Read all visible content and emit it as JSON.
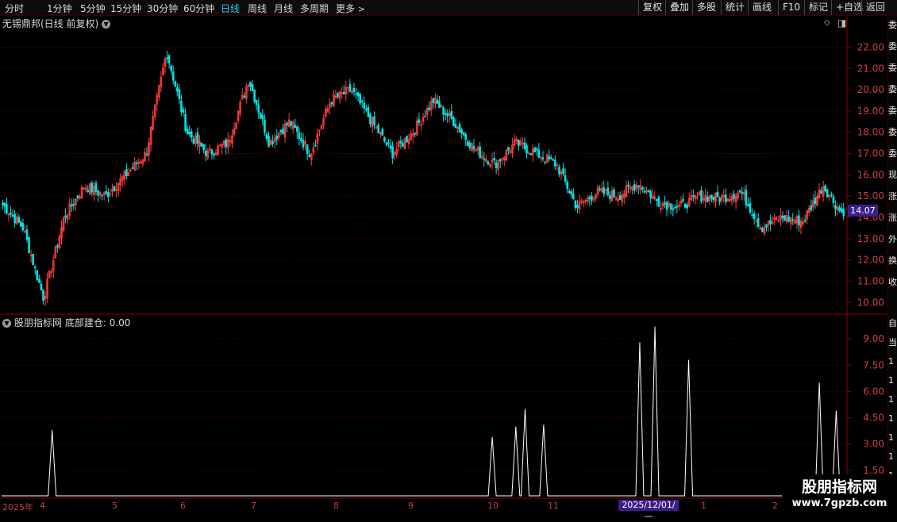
{
  "toolbar": {
    "timeframes": [
      "分时",
      "1分钟",
      "5分钟",
      "15分钟",
      "30分钟",
      "60分钟",
      "日线",
      "周线",
      "月线",
      "多周期",
      "更多"
    ],
    "active_timeframe": "日线",
    "more_arrow": ">",
    "buttons": [
      "复权",
      "叠加",
      "多股",
      "统计",
      "画线",
      "F10",
      "标记",
      "+自选",
      "返回"
    ]
  },
  "chart_title": "无锡鼎邦(日线 前复权)",
  "indicator_title": "股朋指标网 底部建仓: 0.00",
  "last_price_tag": "14.07",
  "highlight_date": "2025/12/01/—",
  "watermark": {
    "line1": "股朋指标网",
    "line2": "www.7gpzb.com"
  },
  "side_panel_chars": [
    "委",
    "委",
    "委",
    "委",
    "委",
    "委",
    "委",
    "现",
    "涨",
    "涨",
    "外",
    "换",
    "收"
  ],
  "side_panel_lower_chars": [
    "自",
    "当",
    "1",
    "1",
    "1",
    "1",
    "1",
    "1",
    "1"
  ],
  "icons": {
    "collapse": "chevron-down-icon",
    "diamond": "diamond-icon",
    "window": "window-icon"
  },
  "colors": {
    "up": "#ff3d3d",
    "down": "#00e5e5",
    "bg": "#000000",
    "grid": "#5a0000",
    "axis": "#8b0000",
    "active": "#35c4ff",
    "tag": "#3e1d8a"
  },
  "chart_data": [
    {
      "type": "candlestick",
      "yticks": [
        "10.00",
        "11.00",
        "12.00",
        "13.00",
        "14.00",
        "15.00",
        "16.00",
        "17.00",
        "18.00",
        "19.00",
        "20.00",
        "21.00",
        "22.00"
      ],
      "ylim": [
        9.6,
        22.8
      ],
      "x_labels": [
        "2025年",
        "4",
        "5",
        "6",
        "7",
        "8",
        "9",
        "10",
        "11",
        "2025/12/01/—",
        "1",
        "2"
      ],
      "close_path": [
        14.6,
        13.5,
        10.2,
        14.0,
        15.5,
        15.0,
        16.0,
        17.0,
        21.8,
        18.0,
        17.0,
        17.5,
        20.5,
        17.5,
        18.5,
        17.0,
        19.5,
        20.0,
        18.5,
        17.0,
        18.0,
        19.5,
        18.5,
        17.2,
        16.5,
        17.5,
        17.0,
        16.5,
        14.5,
        15.2,
        15.0,
        15.6,
        14.7,
        14.5,
        15.0,
        14.9,
        15.2,
        13.5,
        14.0,
        13.8,
        15.5,
        14.07
      ],
      "last": 14.07
    },
    {
      "type": "line",
      "name": "底部建仓",
      "yticks": [
        "1.50",
        "3.00",
        "4.50",
        "6.00",
        "7.50",
        "9.00"
      ],
      "ylim": [
        0,
        10
      ],
      "peaks": [
        {
          "i": 0.06,
          "v": 3.8
        },
        {
          "i": 0.582,
          "v": 3.4
        },
        {
          "i": 0.61,
          "v": 4.0
        },
        {
          "i": 0.621,
          "v": 5.0
        },
        {
          "i": 0.643,
          "v": 4.1
        },
        {
          "i": 0.757,
          "v": 8.8
        },
        {
          "i": 0.775,
          "v": 9.7
        },
        {
          "i": 0.815,
          "v": 7.8
        },
        {
          "i": 0.97,
          "v": 6.5
        },
        {
          "i": 0.99,
          "v": 4.9
        }
      ],
      "current": 0.0
    }
  ]
}
